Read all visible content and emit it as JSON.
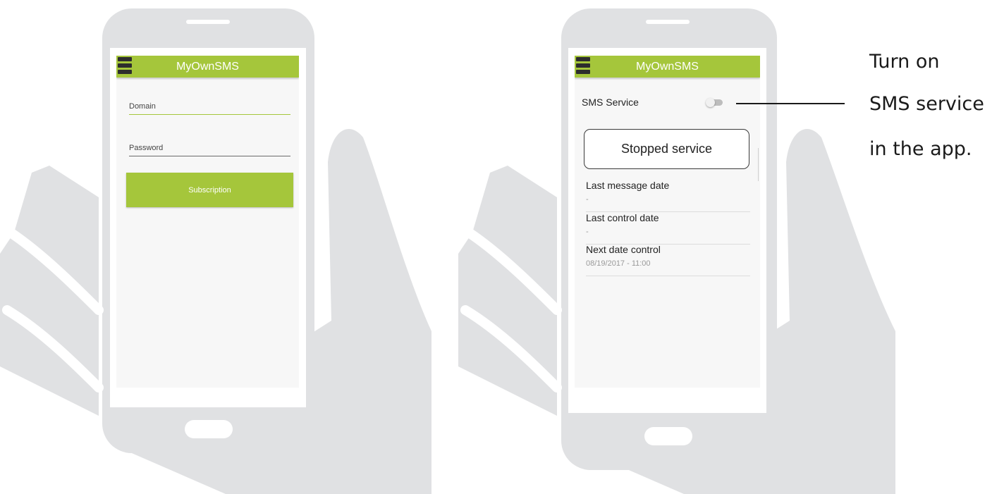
{
  "colors": {
    "accent": "#a5c63b",
    "device": "#e0e1e3",
    "screen": "#f7f7f7"
  },
  "left_phone": {
    "app_title": "MyOwnSMS",
    "domain_placeholder": "Domain",
    "password_placeholder": "Password",
    "subscription_label": "Subscription"
  },
  "right_phone": {
    "app_title": "MyOwnSMS",
    "sms_service_label": "SMS Service",
    "toggle_on": false,
    "status_button_label": "Stopped service",
    "info_rows": [
      {
        "label": "Last message date",
        "value": "-"
      },
      {
        "label": "Last control date",
        "value": "-"
      },
      {
        "label": "Next date control",
        "value": "08/19/2017 - 11:00"
      }
    ]
  },
  "caption": {
    "line1": "Turn on",
    "line2": "SMS service",
    "line3": "in the app."
  }
}
